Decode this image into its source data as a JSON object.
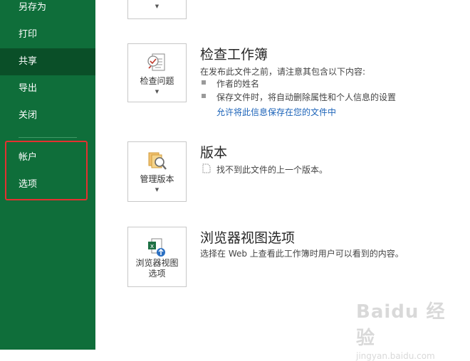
{
  "sidebar": {
    "items": [
      {
        "label": "另存为"
      },
      {
        "label": "打印"
      },
      {
        "label": "共享"
      },
      {
        "label": "导出"
      },
      {
        "label": "关闭"
      },
      {
        "label": "帐户"
      },
      {
        "label": "选项"
      }
    ],
    "active_index": 2
  },
  "inspect": {
    "button_label": "检查问题",
    "title": "检查工作簿",
    "description": "在发布此文件之前，请注意其包含以下内容:",
    "bullets": [
      "作者的姓名",
      "保存文件时，将自动删除属性和个人信息的设置"
    ],
    "link": "允许将此信息保存在您的文件中"
  },
  "versions": {
    "button_label": "管理版本",
    "title": "版本",
    "status": "找不到此文件的上一个版本。"
  },
  "browser_view": {
    "button_label_1": "浏览器视图",
    "button_label_2": "选项",
    "title": "浏览器视图选项",
    "description": "选择在 Web 上查看此工作簿时用户可以看到的内容。"
  },
  "watermark": {
    "brand": "Baidu 经验",
    "url": "jingyan.baidu.com"
  },
  "colors": {
    "sidebar_bg": "#0f6e3a",
    "sidebar_active": "#0a4f28",
    "highlight": "#e53030",
    "link": "#1a62b8"
  }
}
